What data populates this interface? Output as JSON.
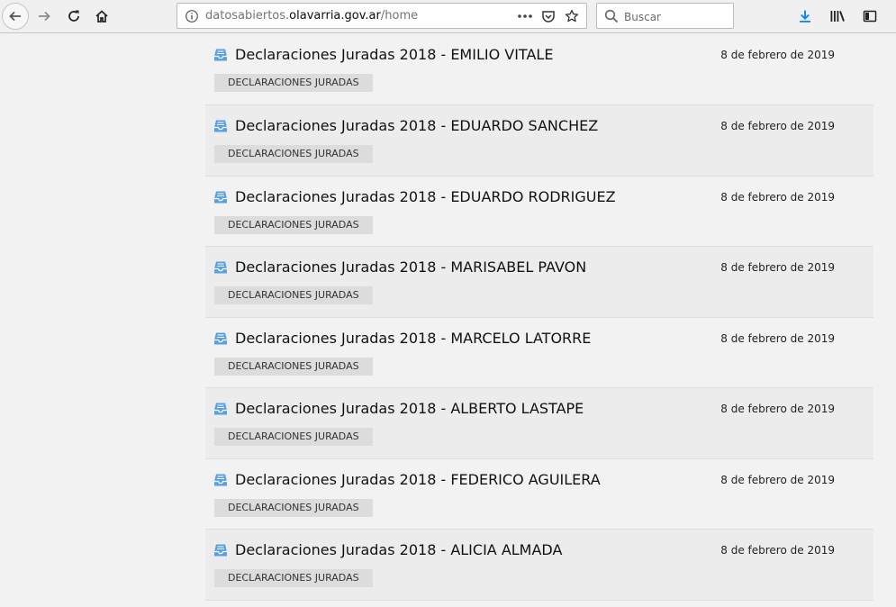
{
  "browser": {
    "url_prefix": "datosabiertos.",
    "url_domain": "olavarria.gov.ar",
    "url_path": "/home",
    "search_placeholder": "Buscar",
    "icons": [
      "back-icon",
      "forward-icon",
      "reload-icon",
      "home-icon",
      "info-icon",
      "more-icon",
      "pocket-icon",
      "bookmark-star-icon",
      "search-icon",
      "download-icon",
      "library-icon",
      "sidebar-icon"
    ]
  },
  "datasets": [
    {
      "title": "Declaraciones Juradas 2018 - EMILIO VITALE",
      "date": "8 de febrero de 2019",
      "tag": "DECLARACIONES JURADAS"
    },
    {
      "title": "Declaraciones Juradas 2018 - EDUARDO SANCHEZ",
      "date": "8 de febrero de 2019",
      "tag": "DECLARACIONES JURADAS"
    },
    {
      "title": "Declaraciones Juradas 2018 - EDUARDO RODRIGUEZ",
      "date": "8 de febrero de 2019",
      "tag": "DECLARACIONES JURADAS"
    },
    {
      "title": "Declaraciones Juradas 2018 - MARISABEL PAVON",
      "date": "8 de febrero de 2019",
      "tag": "DECLARACIONES JURADAS"
    },
    {
      "title": "Declaraciones Juradas 2018 - MARCELO LATORRE",
      "date": "8 de febrero de 2019",
      "tag": "DECLARACIONES JURADAS"
    },
    {
      "title": "Declaraciones Juradas 2018 - ALBERTO LASTAPE",
      "date": "8 de febrero de 2019",
      "tag": "DECLARACIONES JURADAS"
    },
    {
      "title": "Declaraciones Juradas 2018 - FEDERICO AGUILERA",
      "date": "8 de febrero de 2019",
      "tag": "DECLARACIONES JURADAS"
    },
    {
      "title": "Declaraciones Juradas 2018 - ALICIA ALMADA",
      "date": "8 de febrero de 2019",
      "tag": "DECLARACIONES JURADAS"
    }
  ],
  "colors": {
    "dataset_icon": "#5aa0e0",
    "download_icon": "#0a84ff"
  }
}
